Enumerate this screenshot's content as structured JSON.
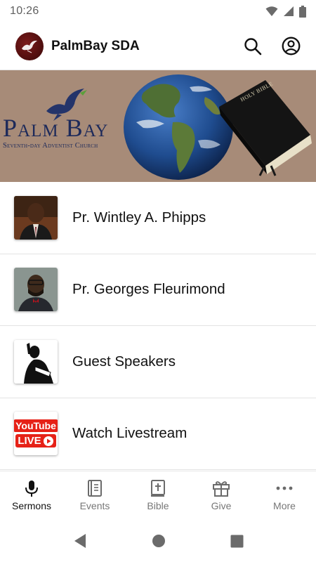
{
  "status_bar": {
    "time": "10:26"
  },
  "app_bar": {
    "title": "PalmBay SDA"
  },
  "banner": {
    "title": "Palm Bay",
    "subtitle": "Seventh-day Adventist Church",
    "bible_text": "HOLY BIBLE"
  },
  "list": {
    "items": [
      {
        "label": "Pr. Wintley A. Phipps",
        "thumb_icon": "person-portrait-icon"
      },
      {
        "label": "Pr. Georges Fleurimond",
        "thumb_icon": "person-portrait-icon"
      },
      {
        "label": "Guest Speakers",
        "thumb_icon": "speaker-silhouette-icon"
      },
      {
        "label": "Watch Livestream",
        "thumb_icon": "youtube-live-icon",
        "thumb_text_top": "YouTube",
        "thumb_text_bottom": "LIVE"
      }
    ]
  },
  "bottom_nav": {
    "active": "Sermons",
    "items": [
      {
        "label": "Sermons",
        "icon": "microphone-icon"
      },
      {
        "label": "Events",
        "icon": "calendar-book-icon"
      },
      {
        "label": "Bible",
        "icon": "bible-icon"
      },
      {
        "label": "Give",
        "icon": "gift-icon"
      },
      {
        "label": "More",
        "icon": "more-dots-icon"
      }
    ]
  },
  "colors": {
    "banner_bg": "#a78b78",
    "banner_text": "#1d2a5a",
    "logo_bg": "#5a0f0f",
    "youtube_red": "#e62117"
  }
}
